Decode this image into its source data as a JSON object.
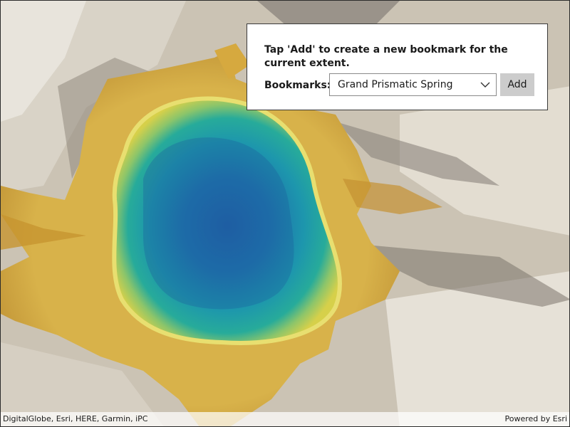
{
  "panel": {
    "instructions": "Tap 'Add' to create a new bookmark for the current extent.",
    "bookmarks_label": "Bookmarks:",
    "selected_bookmark": "Grand Prismatic Spring",
    "add_label": "Add"
  },
  "attribution": {
    "left": "DigitalGlobe, Esri, HERE, Garmin, iPC",
    "right": "Powered by Esri"
  },
  "icons": {
    "dropdown": "chevron-down-icon"
  },
  "colors": {
    "spring_center": "#1f6aa8",
    "spring_teal": "#1fa6a6",
    "spring_yellow": "#d9cf49",
    "mat_orange": "#c9962e",
    "terrain": "#cfc8bb"
  }
}
